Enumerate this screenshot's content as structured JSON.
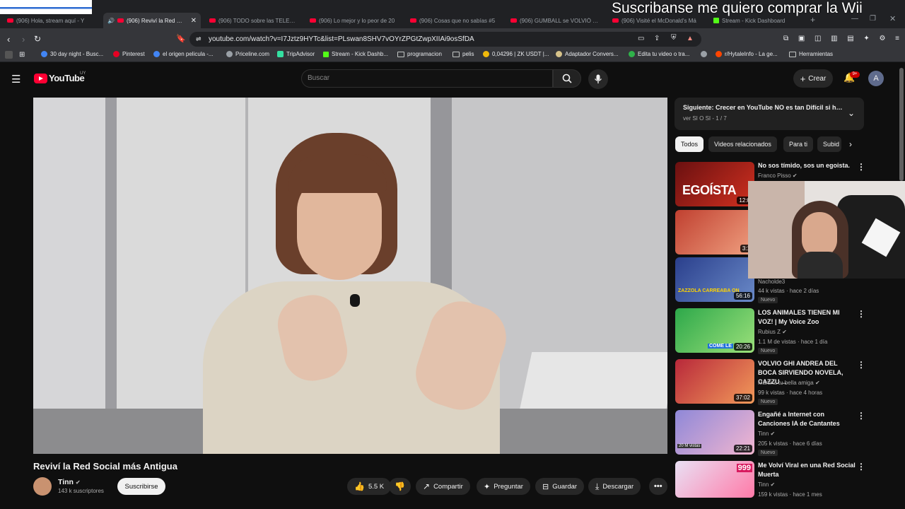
{
  "browser": {
    "overlay_text": "Suscribanse me quiero comprar la Wii",
    "tabs": [
      {
        "title": "(906) Hola, stream aquí - Y",
        "icon": "yt"
      },
      {
        "title": "(906) Reviví la Red Soci",
        "icon": "yt",
        "active": true
      },
      {
        "title": "(906) TODO sobre las TELES D",
        "icon": "yt"
      },
      {
        "title": "(906) Lo mejor y lo peor de 20",
        "icon": "yt"
      },
      {
        "title": "(906) Cosas que no sabías #5",
        "icon": "yt"
      },
      {
        "title": "(906) GUMBALL se VOLVIÓ SO",
        "icon": "yt"
      },
      {
        "title": "(906) Visité el McDonald's Má",
        "icon": "yt"
      },
      {
        "title": "Stream - Kick Dashboard",
        "icon": "kick"
      }
    ],
    "url": "youtube.com/watch?v=I7Jztz9HYTc&list=PLswan8SHV7vOYrZPGtZwpXIIAi9osSfDA",
    "bookmarks": [
      "30 day night - Busc...",
      "Pinterest",
      "el origen pelicula -...",
      "Priceline.com",
      "TripAdvisor",
      "Stream - Kick Dashb...",
      "programacion",
      "pelis",
      "0,04296 | ZK USDT |...",
      "Adaptador Convers...",
      "Edita tu video o tra...",
      "r/HytaleInfo - La ge...",
      "Herramientas"
    ]
  },
  "youtube": {
    "logo_text": "YouTube",
    "logo_region": "UY",
    "search_placeholder": "Buscar",
    "create_label": "Crear",
    "notif_count": "9+",
    "avatar_letter": "A"
  },
  "video": {
    "title": "Reviví la Red Social más Antigua",
    "channel": "Tinn",
    "subscribers": "143 k suscriptores",
    "subscribe_label": "Suscribirse",
    "likes": "5.5 K",
    "share": "Compartir",
    "ask": "Preguntar",
    "save": "Guardar",
    "download": "Descargar"
  },
  "up_next": {
    "title": "Siguiente: Crecer en YouTube NO es tan Difícil si ha...",
    "subtitle": "ver SI O SI - 1 / 7"
  },
  "chips": [
    "Todos",
    "Videos relacionados",
    "Para ti",
    "Subid"
  ],
  "recommendations": [
    {
      "title": "No sos tímido, sos un egoista.",
      "channel": "Franco Pisso",
      "meta": "",
      "new": false,
      "duration": "12:0",
      "thumb_text": "EGOÍSTA"
    },
    {
      "title": "",
      "channel": "",
      "meta": "",
      "new": false,
      "duration": "3:1"
    },
    {
      "title": "",
      "channel": "Nacholde3",
      "meta": "44 k vistas · hace 2 días",
      "new": true,
      "duration": "56:16",
      "thumb_text": "ZAZZOLA CARREABA ON"
    },
    {
      "title": "LOS ANIMALES TIENEN MI VOZ! | My Voice Zoo",
      "channel": "Rubius Z",
      "meta": "1.1 M de vistas · hace 1 día",
      "new": true,
      "duration": "20:26",
      "thumb_text": "COME LE"
    },
    {
      "title": "VOLVIO GHI ANDREA DEL BOCA SIRVIENDO NOVELA, CAZZU ...",
      "channel": "Martina tu bella amiga",
      "meta": "99 k vistas · hace 4 horas",
      "new": true,
      "duration": "37:02"
    },
    {
      "title": "Engañé a Internet con Canciones IA de Cantantes",
      "channel": "Tinn",
      "meta": "205 k vistas · hace 6 días",
      "new": true,
      "duration": "22:21",
      "thumb_text": "20 M vistas"
    },
    {
      "title": "Me Volví Viral en una Red Social Muerta",
      "channel": "Tinn",
      "meta": "159 k vistas · hace 1 mes",
      "new": false,
      "duration": "",
      "thumb_text": "999"
    }
  ],
  "new_label": "Nuevo"
}
